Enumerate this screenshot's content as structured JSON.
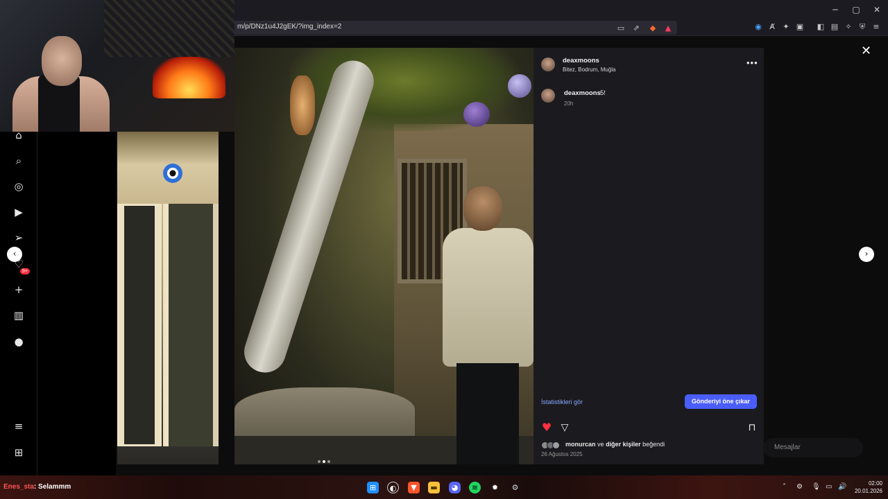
{
  "browser": {
    "url": "m/p/DNz1u4J2gEK/?img_index=2",
    "window_controls": {
      "minimize": "─",
      "maximize": "▢",
      "close": "✕"
    }
  },
  "stream_overlay": {
    "chat_user": "Enes_sta",
    "chat_message": ": Selammm"
  },
  "instagram": {
    "sidebar_badge": "9+",
    "post": {
      "username": "deaxmoons",
      "location": "Bitez, Bodrum, Muğla",
      "more_label": "•••",
      "comment": {
        "username": "deaxmoons",
        "text": "5!",
        "time": "20h"
      },
      "stats_link": "İstatistikleri gör",
      "boost_button": "Gönderiyi öne çıkar",
      "likes": {
        "first_user": "monurcan",
        "connector": "ve",
        "others": "diğer kişiler",
        "suffix": "beğendi"
      },
      "date": "26 Ağustos 2025",
      "carousel": {
        "count": 3,
        "active_index": 1
      }
    },
    "messages_label": "Mesajlar",
    "close_label": "✕",
    "prev_label": "‹",
    "next_label": "›"
  },
  "taskbar": {
    "clock_time": "02:00",
    "clock_date": "20.01.2026"
  },
  "colors": {
    "accent_blue": "#4a5df9",
    "link_blue": "#8aa6ff",
    "like_red": "#ff3040",
    "panel_bg": "#1b1b1f"
  }
}
